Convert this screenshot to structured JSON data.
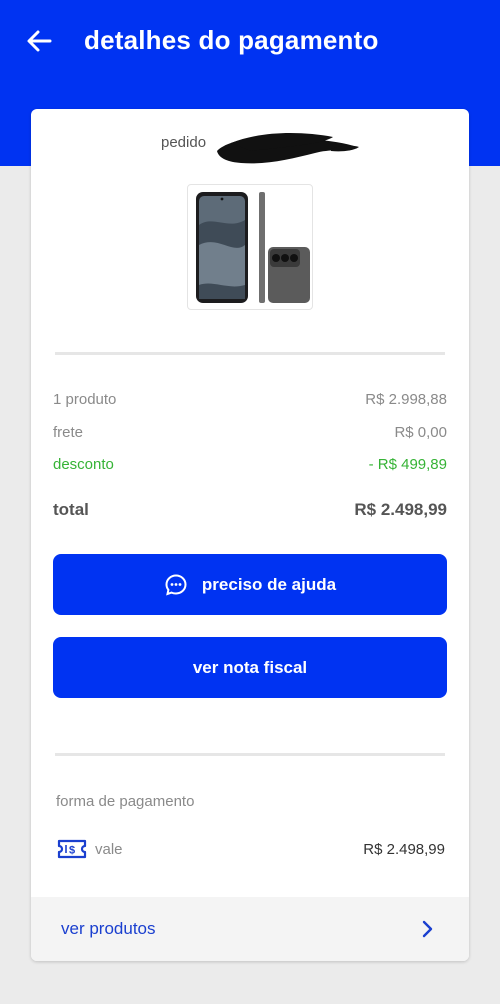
{
  "header": {
    "title": "detalhes do pagamento",
    "back_icon": "arrow-left-icon",
    "background": "#0033f2"
  },
  "order": {
    "label": "pedido"
  },
  "product": {
    "image_icon": "smartphone-image"
  },
  "summary": {
    "products": {
      "label": "1 produto",
      "value": "R$ 2.998,88"
    },
    "shipping": {
      "label": "frete",
      "value": "R$ 0,00"
    },
    "discount": {
      "label": "desconto",
      "value": "- R$ 499,89",
      "color": "#36b336"
    },
    "total": {
      "label": "total",
      "value": "R$ 2.498,99"
    }
  },
  "actions": {
    "help_label": "preciso de ajuda",
    "help_icon": "chat-bubble-icon",
    "invoice_label": "ver nota fiscal"
  },
  "payment": {
    "title": "forma de pagamento",
    "method": "vale",
    "method_icon": "voucher-icon",
    "amount": "R$ 2.498,99"
  },
  "footer": {
    "label": "ver produtos",
    "icon": "chevron-right-icon"
  }
}
